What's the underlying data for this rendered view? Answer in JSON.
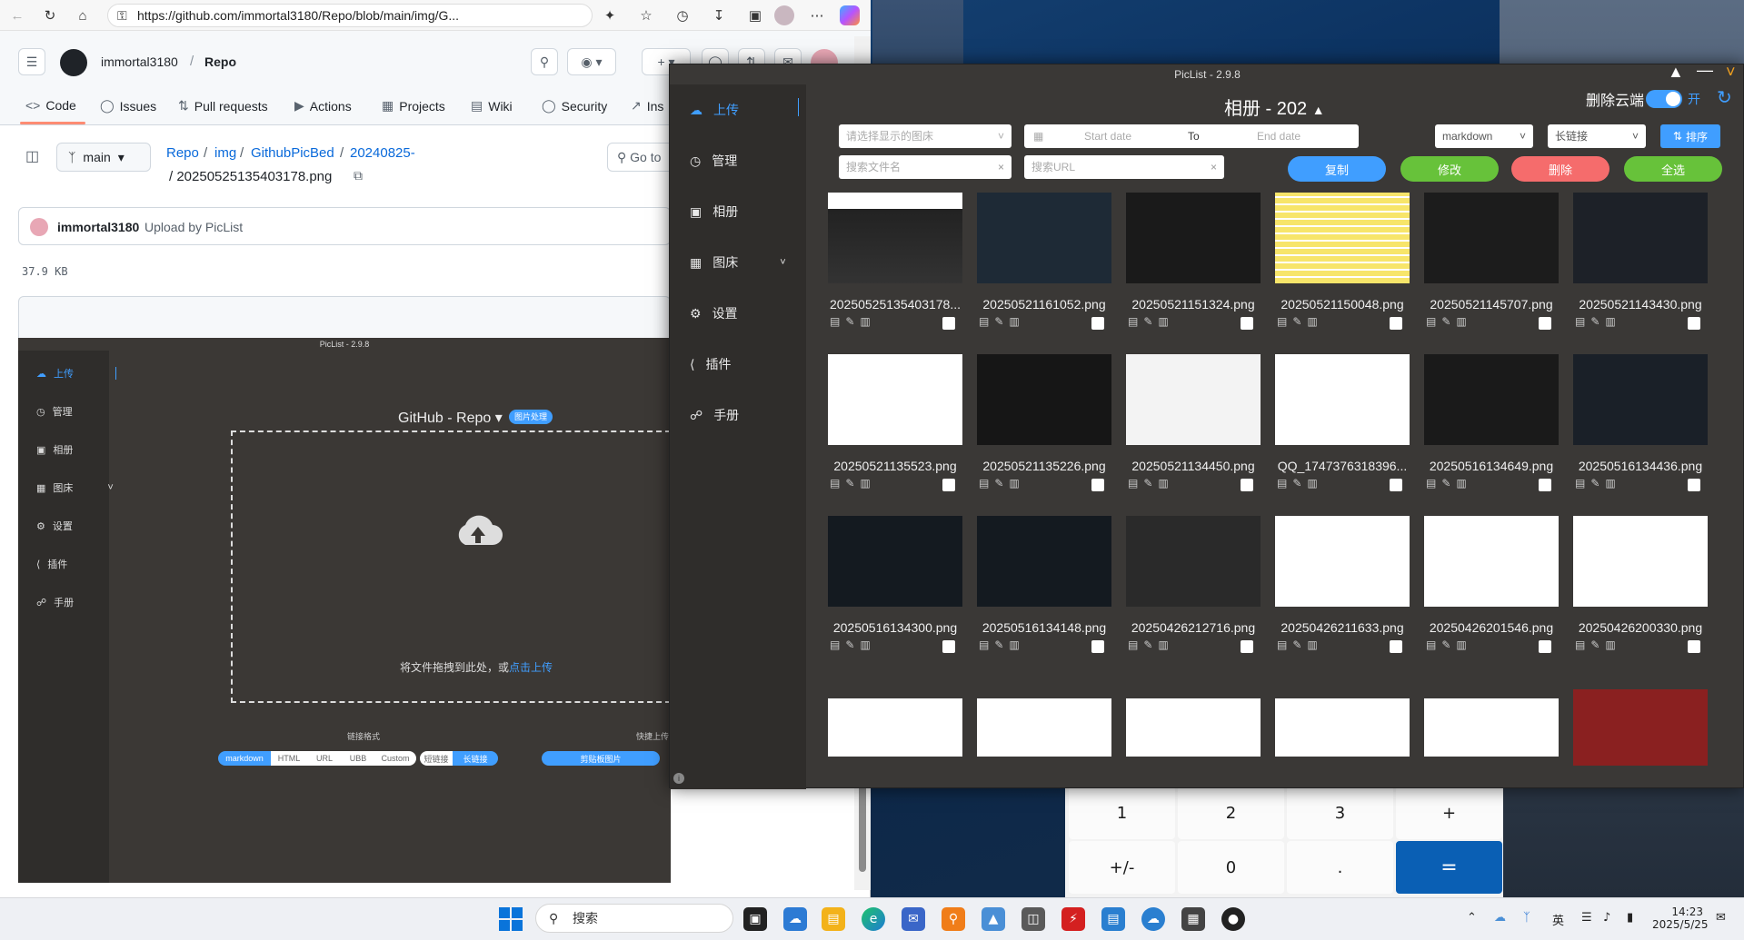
{
  "browser": {
    "url": "https://github.com/immortal3180/Repo/blob/main/img/G..."
  },
  "github": {
    "owner": "immortal3180",
    "repo": "Repo",
    "tabs": [
      "Code",
      "Issues",
      "Pull requests",
      "Actions",
      "Projects",
      "Wiki",
      "Security",
      "Ins"
    ],
    "branch": "main",
    "breadcrumb": [
      "Repo",
      "img",
      "GithubPicBed",
      "20240825-"
    ],
    "filename": "20250525135403178.png",
    "goto": "Go to",
    "commit_user": "immortal3180",
    "commit_msg": "Upload by PicList",
    "filesize": "37.9 KB"
  },
  "mini_piclist": {
    "title": "PicList - 2.9.8",
    "heading": "GitHub - Repo",
    "badge": "图片处理",
    "drop_text": "将文件拖拽到此处，或",
    "drop_link": "点击上传",
    "link_format_label": "链接格式",
    "quick_upload_label": "快捷上传",
    "formats": [
      "markdown",
      "HTML",
      "URL",
      "UBB",
      "Custom"
    ],
    "short_long": [
      "短链接",
      "长链接"
    ],
    "clipboard_btn": "剪贴板图片",
    "menu": [
      "上传",
      "管理",
      "相册",
      "图床",
      "设置",
      "插件",
      "手册"
    ]
  },
  "piclist": {
    "title": "PicList - 2.9.8",
    "menu": [
      "上传",
      "管理",
      "相册",
      "图床",
      "设置",
      "插件",
      "手册"
    ],
    "album_title": "相册 - 202",
    "delete_cloud": "删除云端",
    "toggle_label": "开",
    "bed_select_placeholder": "请选择显示的图床",
    "start_date": "Start date",
    "to": "To",
    "end_date": "End date",
    "format_select": "markdown",
    "link_select": "长链接",
    "sort_btn": "排序",
    "search_file_placeholder": "搜索文件名",
    "search_url_placeholder": "搜索URL",
    "btn_copy": "复制",
    "btn_modify": "修改",
    "btn_delete": "删除",
    "btn_all": "全选",
    "colors": {
      "blue": "#409eff",
      "green": "#67c23a",
      "red": "#f56c6c"
    },
    "images": [
      "20250525135403178...",
      "20250521161052.png",
      "20250521151324.png",
      "20250521150048.png",
      "20250521145707.png",
      "20250521143430.png",
      "20250521135523.png",
      "20250521135226.png",
      "20250521134450.png",
      "QQ_1747376318396...",
      "20250516134649.png",
      "20250516134436.png",
      "20250516134300.png",
      "20250516134148.png",
      "20250426212716.png",
      "20250426211633.png",
      "20250426201546.png",
      "20250426200330.png"
    ]
  },
  "calculator": {
    "keys_row1": [
      "1",
      "2",
      "3",
      "+"
    ],
    "keys_row2": [
      "+/-",
      "0",
      ".",
      "="
    ]
  },
  "taskbar": {
    "search": "搜索",
    "ime": "英",
    "time": "14:23",
    "date": "2025/5/25"
  }
}
